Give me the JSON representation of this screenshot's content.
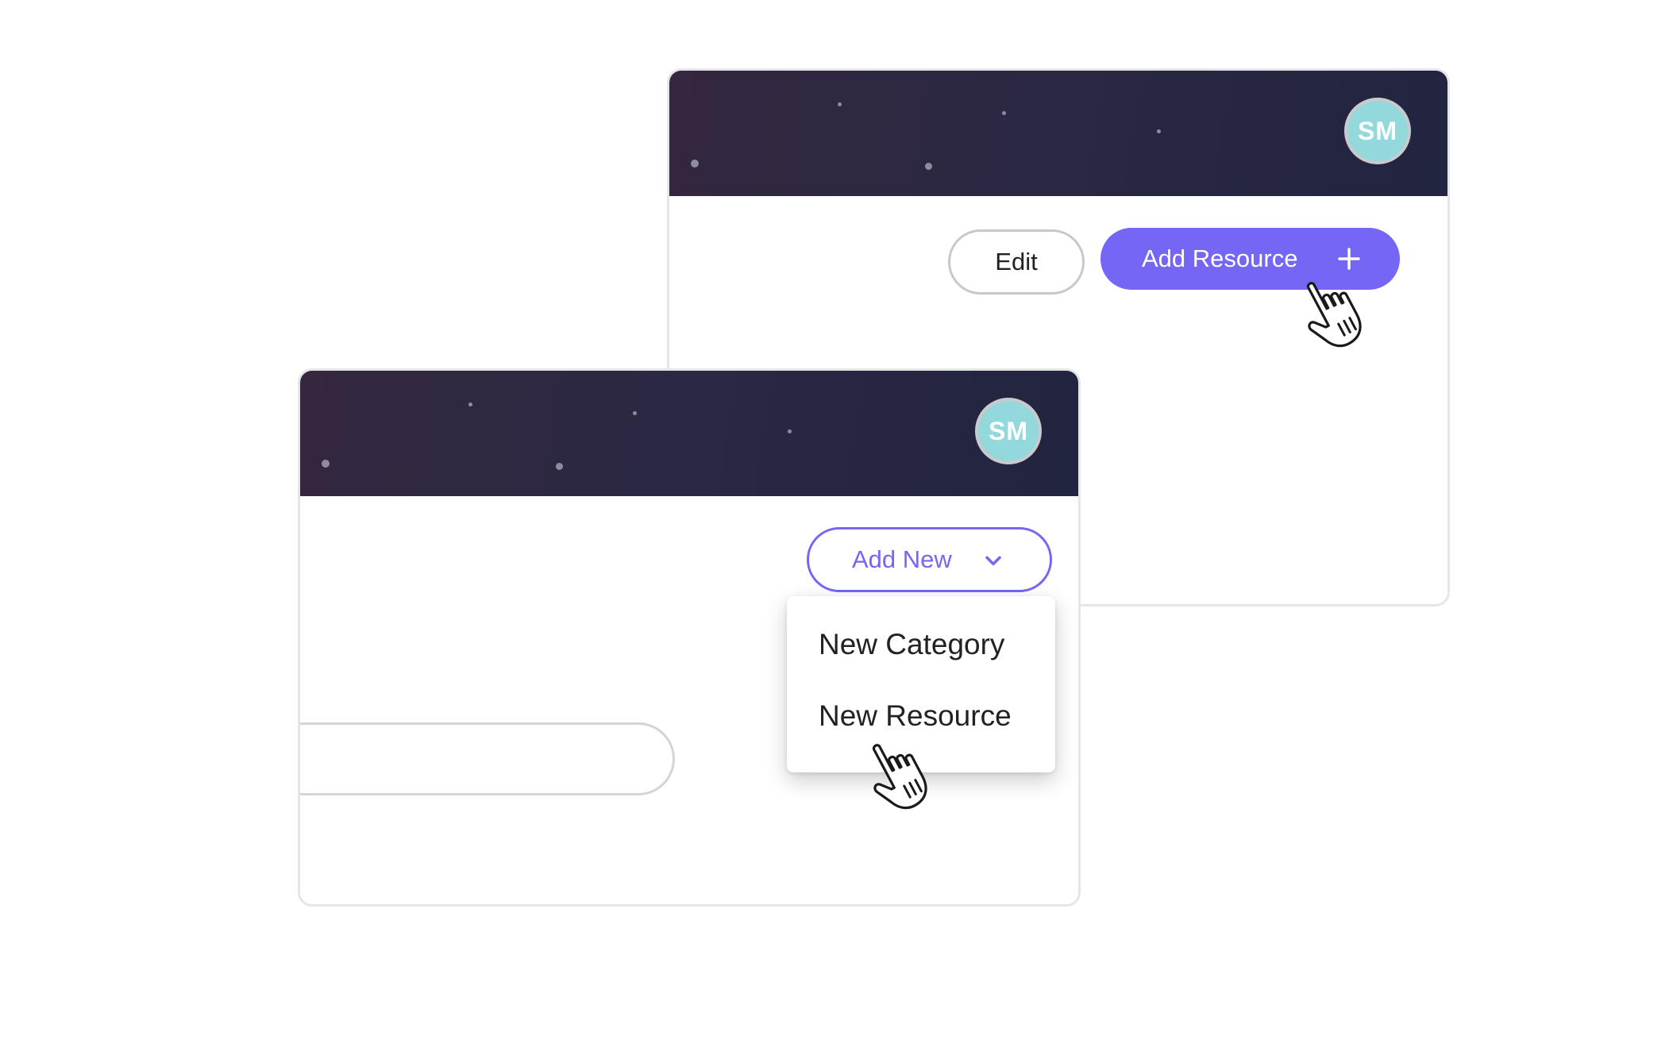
{
  "back_window": {
    "avatar_initials": "SM",
    "edit_label": "Edit",
    "add_resource_label": "Add Resource"
  },
  "front_window": {
    "avatar_initials": "SM",
    "add_new_label": "Add New",
    "menu_items": [
      {
        "label": "New Category"
      },
      {
        "label": "New Resource"
      }
    ]
  },
  "colors": {
    "accent": "#7566f6",
    "header_dark": "#2b2843",
    "avatar": "#93d9db"
  },
  "icons": {
    "add": "plus-icon",
    "dropdown": "chevron-down-icon",
    "pointer": "hand-pointer-icon"
  }
}
